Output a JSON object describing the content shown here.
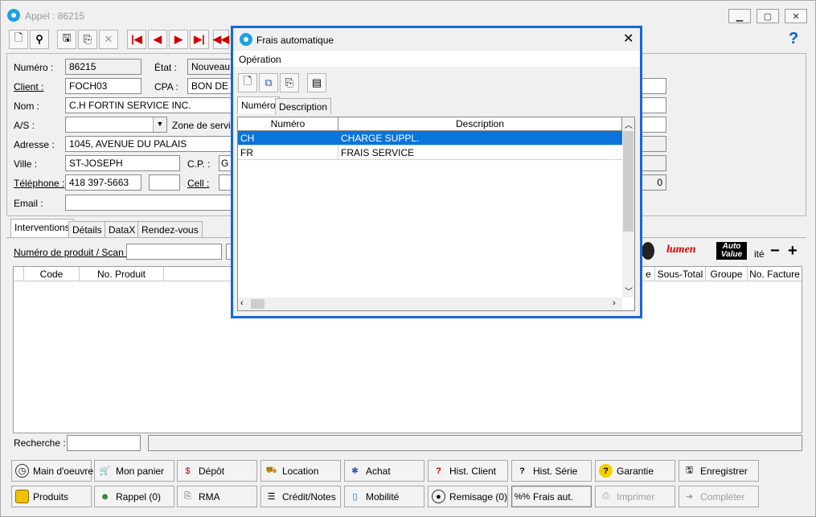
{
  "window": {
    "title": "Appel : 86215",
    "help_icon": "?"
  },
  "toolbar": {
    "icons": [
      "new-icon",
      "search-icon",
      "save-icon",
      "copy-icon",
      "delete-icon",
      "first-icon",
      "prev-icon",
      "next-icon",
      "last-icon",
      "rewind-icon"
    ]
  },
  "form": {
    "numero": {
      "label": "Numéro :",
      "value": "86215"
    },
    "etat": {
      "label": "État :",
      "value": "Nouveau"
    },
    "client": {
      "label": "Client :",
      "value": "FOCH03"
    },
    "cpa": {
      "label": "CPA :",
      "value": "BON DE T"
    },
    "nom": {
      "label": "Nom :",
      "value": "C.H FORTIN SERVICE INC."
    },
    "as": {
      "label": "A/S :",
      "value": ""
    },
    "zone": {
      "label": "Zone de servic"
    },
    "adresse": {
      "label": "Adresse :",
      "value": "1045, AVENUE DU  PALAIS"
    },
    "ville": {
      "label": "Ville :",
      "value": "ST-JOSEPH"
    },
    "cp": {
      "label": "C.P. :",
      "value": "G"
    },
    "telephone": {
      "label": "Téléphone :",
      "value": "418 397-5663"
    },
    "cell": {
      "label": "Cell :",
      "value": ""
    },
    "email": {
      "label": "Email :",
      "value": ""
    },
    "right_value": "0"
  },
  "tabs": [
    "Interventions",
    "Détails",
    "DataX",
    "Rendez-vous"
  ],
  "scan": {
    "label": "Numéro de produit / Scan :"
  },
  "brands": {
    "lumen": "lumen",
    "autovalue_1": "Auto",
    "autovalue_2": "Value",
    "ite": "ité",
    "minus": "−",
    "plus": "+"
  },
  "grid": {
    "left_columns": [
      "Code",
      "No. Produit"
    ],
    "right_columns": [
      "e",
      "Sous-Total",
      "Groupe",
      "No. Facture"
    ]
  },
  "recherche": {
    "label": "Recherche :"
  },
  "buttons_row1": [
    {
      "label": "Main d'oeuvre",
      "icon": "clock-icon"
    },
    {
      "label": "Mon panier",
      "icon": "cart-icon"
    },
    {
      "label": "Dépôt",
      "icon": "deposit-icon"
    },
    {
      "label": "Location",
      "icon": "location-icon"
    },
    {
      "label": "Achat",
      "icon": "purchase-icon"
    },
    {
      "label": "Hist. Client",
      "icon": "history-client-icon"
    },
    {
      "label": "Hist. Série",
      "icon": "history-serial-icon"
    },
    {
      "label": "Garantie",
      "icon": "warranty-icon"
    },
    {
      "label": "Enregistrer",
      "icon": "save-icon"
    }
  ],
  "buttons_row2": [
    {
      "label": "Produits",
      "icon": "box-icon"
    },
    {
      "label": "Rappel (0)",
      "icon": "person-icon"
    },
    {
      "label": "RMA",
      "icon": "rma-icon"
    },
    {
      "label": "Crédit/Notes",
      "icon": "notes-icon"
    },
    {
      "label": "Mobilité",
      "icon": "mobile-icon"
    },
    {
      "label": "Remisage (0)",
      "icon": "storage-icon"
    },
    {
      "label": "Frais aut.",
      "icon": "percent-icon"
    },
    {
      "label": "Imprimer",
      "icon": "print-icon"
    },
    {
      "label": "Compléter",
      "icon": "complete-icon"
    }
  ],
  "dialog": {
    "title": "Frais automatique",
    "menu": "Opération",
    "tabs": [
      "Numéro",
      "Description"
    ],
    "columns": [
      "Numéro",
      "Description"
    ],
    "rows": [
      {
        "numero": "CH",
        "description": "CHARGE SUPPL."
      },
      {
        "numero": "FR",
        "description": "FRAIS SERVICE"
      }
    ]
  }
}
